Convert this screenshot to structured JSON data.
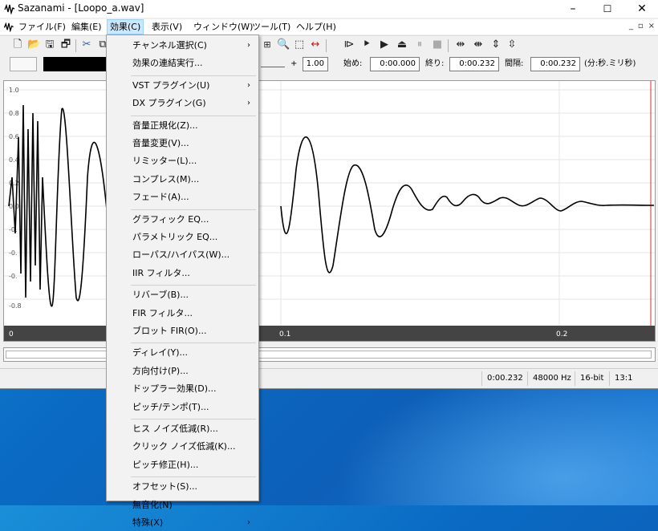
{
  "window": {
    "title": "Sazanami - [Loopo_a.wav]",
    "minimize": "–",
    "maximize": "☐",
    "close": "✕"
  },
  "menubar": {
    "items": [
      "ファイル(F)",
      "編集(E)",
      "効果(C)",
      "表示(V)",
      "ウィンドウ(W)",
      "ツール(T)",
      "ヘルプ(H)"
    ],
    "active_index": 2
  },
  "toolbar2": {
    "zoom_plus": "+",
    "zoom_value": "1.00",
    "start_label": "始め:",
    "start_value": "0:00.000",
    "end_label": "終り:",
    "end_value": "0:00.232",
    "interval_label": "間隔:",
    "interval_value": "0:00.232",
    "unit_label": "(分:秒.ミリ秒)"
  },
  "waveform": {
    "y_labels": [
      "1.0",
      "0.8",
      "0.6",
      "0.4",
      "0.2",
      "0.0",
      "-0.",
      "-0.",
      "-0.",
      "-0.8"
    ],
    "x_labels": [
      "0",
      "0.1",
      "0.2"
    ]
  },
  "statusbar": {
    "position": "0:00.232",
    "sample_rate": "48000 Hz",
    "bit_depth": "16-bit",
    "zoom": "13:1"
  },
  "effects_menu": {
    "items": [
      {
        "label": "チャンネル選択(C)",
        "submenu": true
      },
      {
        "label": "効果の連結実行..."
      },
      {
        "sep": true
      },
      {
        "label": "VST プラグイン(U)",
        "submenu": true
      },
      {
        "label": "DX プラグイン(G)",
        "submenu": true
      },
      {
        "sep": true
      },
      {
        "label": "音量正規化(Z)..."
      },
      {
        "label": "音量変更(V)..."
      },
      {
        "label": "リミッター(L)..."
      },
      {
        "label": "コンプレス(M)..."
      },
      {
        "label": "フェード(A)..."
      },
      {
        "sep": true
      },
      {
        "label": "グラフィック EQ..."
      },
      {
        "label": "パラメトリック EQ..."
      },
      {
        "label": "ローパス/ハイパス(W)..."
      },
      {
        "label": "IIR フィルタ..."
      },
      {
        "sep": true
      },
      {
        "label": "リバーブ(B)..."
      },
      {
        "label": "FIR フィルタ..."
      },
      {
        "label": "ブロット FIR(O)..."
      },
      {
        "sep": true
      },
      {
        "label": "ディレイ(Y)..."
      },
      {
        "label": "方向付け(P)..."
      },
      {
        "label": "ドップラー効果(D)..."
      },
      {
        "label": "ピッチ/テンポ(T)..."
      },
      {
        "sep": true
      },
      {
        "label": "ヒス ノイズ低減(R)..."
      },
      {
        "label": "クリック ノイズ低減(K)..."
      },
      {
        "label": "ピッチ修正(H)..."
      },
      {
        "sep": true
      },
      {
        "label": "オフセット(S)..."
      },
      {
        "label": "無音化(N)"
      },
      {
        "label": "特殊(X)",
        "submenu": true
      }
    ],
    "submenu_arrow": "›"
  }
}
